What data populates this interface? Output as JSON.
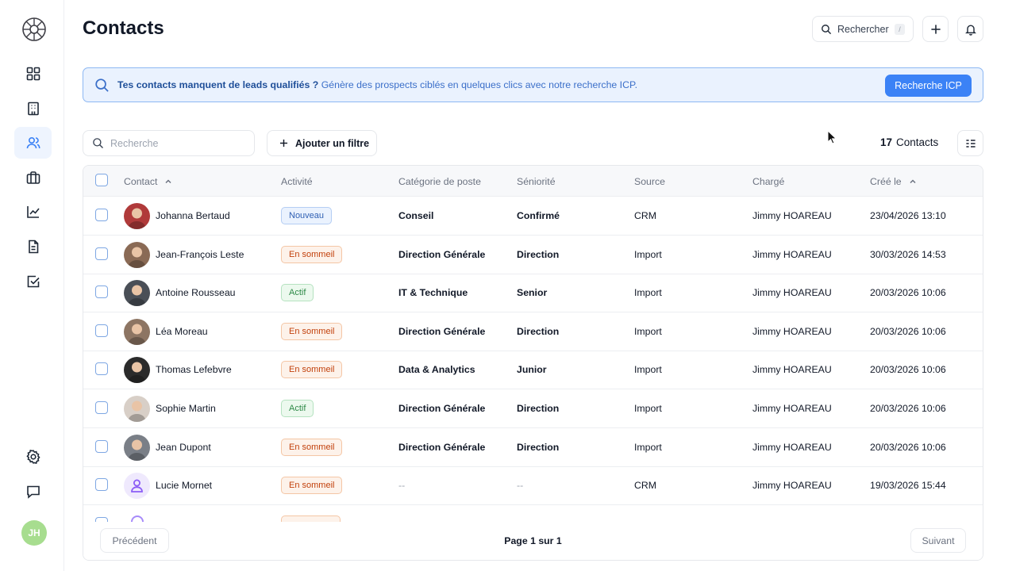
{
  "sidebar": {
    "items": [
      {
        "name": "dashboard",
        "icon": "grid-icon"
      },
      {
        "name": "companies",
        "icon": "building-icon"
      },
      {
        "name": "contacts",
        "icon": "users-icon",
        "active": true
      },
      {
        "name": "deals",
        "icon": "briefcase-icon"
      },
      {
        "name": "analytics",
        "icon": "chart-line-icon"
      },
      {
        "name": "documents",
        "icon": "document-icon"
      },
      {
        "name": "tasks",
        "icon": "checkbox-icon"
      }
    ],
    "bottom": [
      {
        "name": "settings",
        "icon": "gear-icon"
      },
      {
        "name": "messages",
        "icon": "chat-icon"
      }
    ],
    "user_initials": "JH"
  },
  "header": {
    "title": "Contacts",
    "search_label": "Rechercher",
    "search_shortcut": "/"
  },
  "banner": {
    "bold_text": "Tes contacts manquent de leads qualifiés ?",
    "text": " Génère des prospects ciblés en quelques clics avec notre recherche ICP.",
    "button_label": "Recherche ICP"
  },
  "toolbar": {
    "search_placeholder": "Recherche",
    "filter_label": "Ajouter un filtre",
    "count_number": "17",
    "count_label": "Contacts"
  },
  "table": {
    "columns": {
      "contact": "Contact",
      "activite": "Activité",
      "categorie": "Catégorie de poste",
      "seniorite": "Séniorité",
      "source": "Source",
      "charge": "Chargé",
      "cree": "Créé le"
    },
    "rows": [
      {
        "name": "Johanna Bertaud",
        "activite": "Nouveau",
        "status": "nouveau",
        "categorie": "Conseil",
        "seniorite": "Confirmé",
        "source": "CRM",
        "charge": "Jimmy HOAREAU",
        "cree": "23/04/2026 13:10",
        "avatar_color": "#b03a3a"
      },
      {
        "name": "Jean-François Leste",
        "activite": "En sommeil",
        "status": "sommeil",
        "categorie": "Direction Générale",
        "seniorite": "Direction",
        "source": "Import",
        "charge": "Jimmy HOAREAU",
        "cree": "30/03/2026 14:53",
        "avatar_color": "#8a6a55"
      },
      {
        "name": "Antoine Rousseau",
        "activite": "Actif",
        "status": "actif",
        "categorie": "IT & Technique",
        "seniorite": "Senior",
        "source": "Import",
        "charge": "Jimmy HOAREAU",
        "cree": "20/03/2026 10:06",
        "avatar_color": "#4a4f57"
      },
      {
        "name": "Léa Moreau",
        "activite": "En sommeil",
        "status": "sommeil",
        "categorie": "Direction Générale",
        "seniorite": "Direction",
        "source": "Import",
        "charge": "Jimmy HOAREAU",
        "cree": "20/03/2026 10:06",
        "avatar_color": "#8d7563"
      },
      {
        "name": "Thomas Lefebvre",
        "activite": "En sommeil",
        "status": "sommeil",
        "categorie": "Data & Analytics",
        "seniorite": "Junior",
        "source": "Import",
        "charge": "Jimmy HOAREAU",
        "cree": "20/03/2026 10:06",
        "avatar_color": "#2b2b2b"
      },
      {
        "name": "Sophie Martin",
        "activite": "Actif",
        "status": "actif",
        "categorie": "Direction Générale",
        "seniorite": "Direction",
        "source": "Import",
        "charge": "Jimmy HOAREAU",
        "cree": "20/03/2026 10:06",
        "avatar_color": "#d8cfc7"
      },
      {
        "name": "Jean Dupont",
        "activite": "En sommeil",
        "status": "sommeil",
        "categorie": "Direction Générale",
        "seniorite": "Direction",
        "source": "Import",
        "charge": "Jimmy HOAREAU",
        "cree": "20/03/2026 10:06",
        "avatar_color": "#7a7f87"
      },
      {
        "name": "Lucie Mornet",
        "activite": "En sommeil",
        "status": "sommeil",
        "categorie": "--",
        "seniorite": "--",
        "source": "CRM",
        "charge": "Jimmy HOAREAU",
        "cree": "19/03/2026 15:44",
        "avatar_color": "placeholder"
      }
    ]
  },
  "pagination": {
    "prev_label": "Précédent",
    "page_text": "Page 1 sur 1",
    "next_label": "Suivant"
  },
  "colors": {
    "accent": "#3b82f6",
    "banner_bg": "#eaf2fe",
    "active_nav_bg": "#eef4fe"
  }
}
